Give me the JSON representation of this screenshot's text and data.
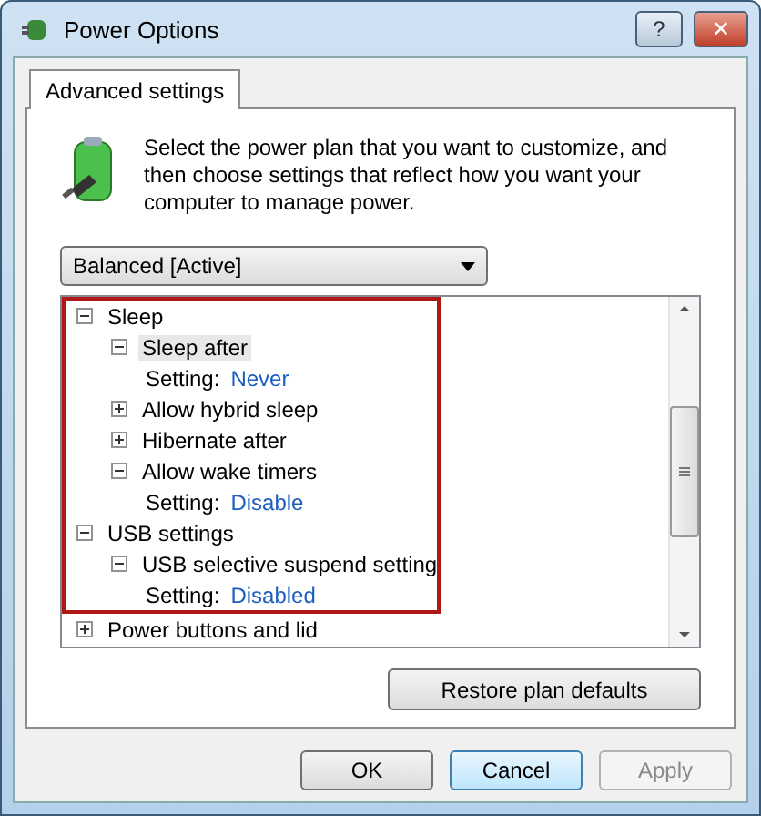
{
  "window": {
    "title": "Power Options",
    "buttons": [
      "?",
      "✕"
    ]
  },
  "tabs": [
    {
      "label": "Advanced settings",
      "selected": true
    }
  ],
  "description": "Select the power plan that you want to customize, and then choose settings that reflect how you want your computer to manage power.",
  "plan_select": {
    "value": "Balanced [Active]"
  },
  "tree": [
    {
      "label": "Sleep",
      "expanded": true,
      "selected": false,
      "highlighted": true,
      "children": [
        {
          "label": "Sleep after",
          "expanded": true,
          "selected": true,
          "children": [
            {
              "kind": "setting",
              "label": "Setting:",
              "value": "Never"
            }
          ]
        },
        {
          "label": "Allow hybrid sleep",
          "expanded": false,
          "selected": false
        },
        {
          "label": "Hibernate after",
          "expanded": false,
          "selected": false
        },
        {
          "label": "Allow wake timers",
          "expanded": true,
          "selected": false,
          "children": [
            {
              "kind": "setting",
              "label": "Setting:",
              "value": "Disable"
            }
          ]
        }
      ]
    },
    {
      "label": "USB settings",
      "expanded": true,
      "selected": false,
      "highlighted": true,
      "children": [
        {
          "label": "USB selective suspend setting",
          "expanded": true,
          "selected": false,
          "children": [
            {
              "kind": "setting",
              "label": "Setting:",
              "value": "Disabled"
            }
          ]
        }
      ]
    },
    {
      "label": "Power buttons and lid",
      "expanded": false,
      "selected": false,
      "highlighted": false
    }
  ],
  "restore_button": "Restore plan defaults",
  "dialog_buttons": [
    {
      "label": "OK",
      "kind": "normal"
    },
    {
      "label": "Cancel",
      "kind": "default"
    },
    {
      "label": "Apply",
      "kind": "disabled"
    }
  ]
}
